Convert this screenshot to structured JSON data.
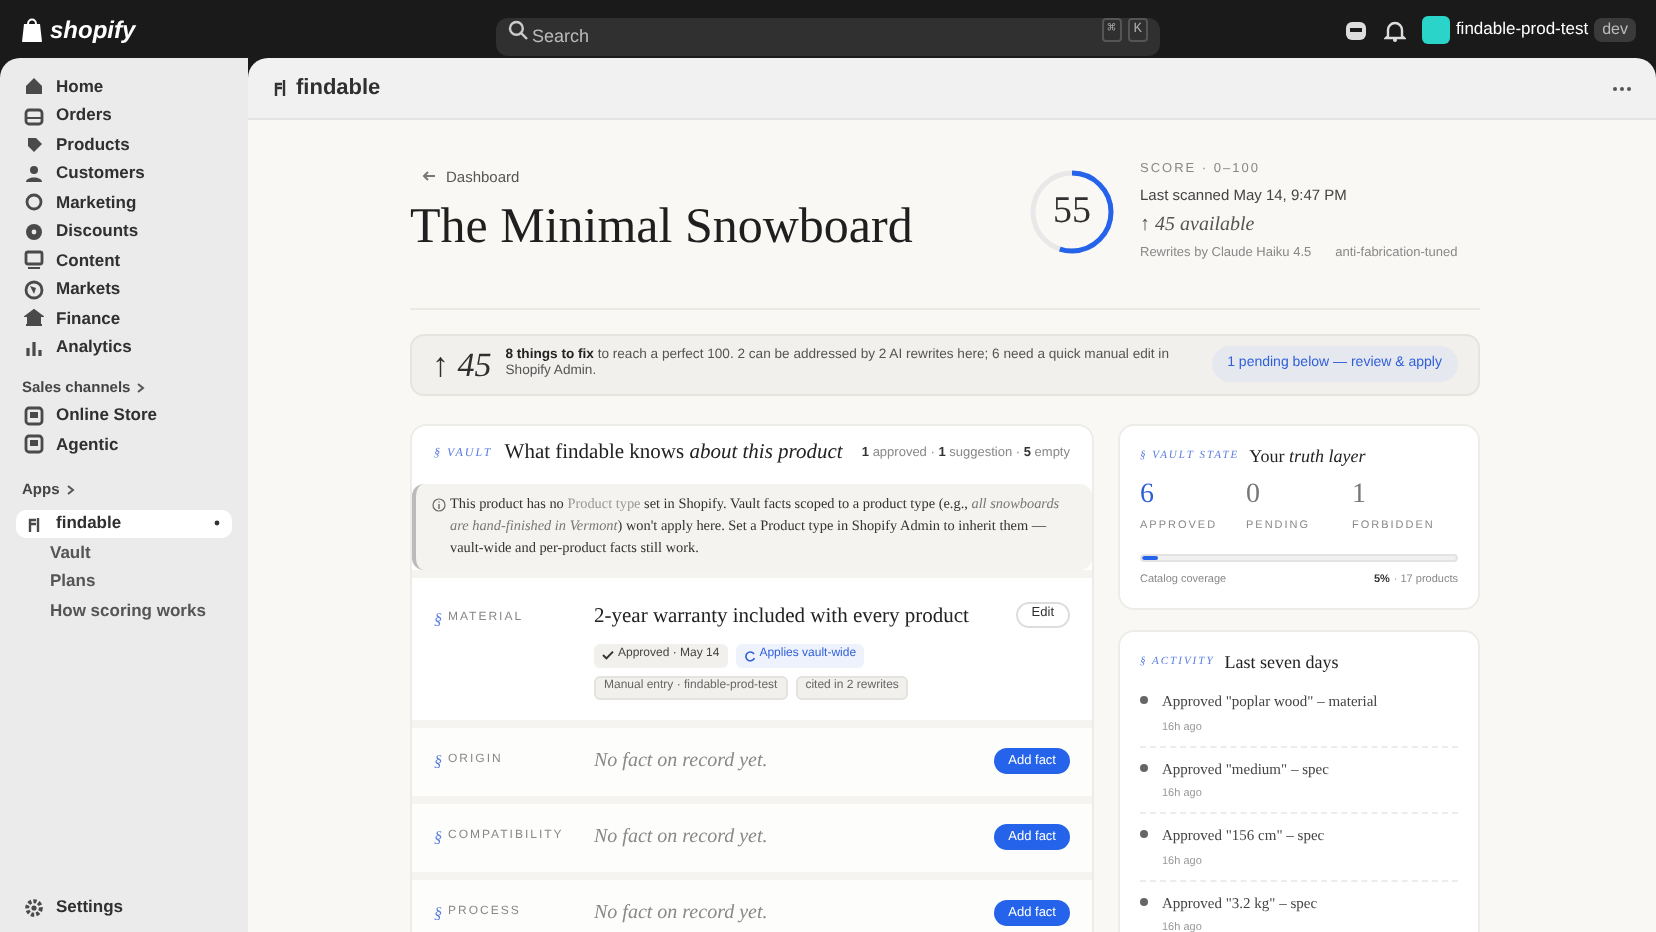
{
  "topbar": {
    "logo": "shopify",
    "search": {
      "placeholder": "Search",
      "keys": [
        "⌘",
        "K"
      ]
    },
    "store": "findable-prod-test",
    "badge": "dev"
  },
  "sidebar": {
    "items": [
      {
        "label": "Home",
        "selected": false
      },
      {
        "label": "Orders",
        "selected": false
      },
      {
        "label": "Products",
        "selected": false
      },
      {
        "label": "Customers",
        "selected": false
      },
      {
        "label": "Marketing",
        "selected": false
      },
      {
        "label": "Discounts",
        "selected": false
      },
      {
        "label": "Content",
        "selected": false
      },
      {
        "label": "Markets",
        "selected": false
      },
      {
        "label": "Finance",
        "selected": false
      },
      {
        "label": "Analytics",
        "selected": false
      }
    ],
    "sales_channels": {
      "heading": "Sales channels",
      "items": [
        {
          "label": "Online Store",
          "selected": false
        },
        {
          "label": "Agentic",
          "selected": false
        }
      ]
    },
    "apps": {
      "heading": "Apps",
      "app": {
        "label": "findable",
        "selected": true,
        "children": [
          {
            "label": "Vault",
            "selected": false
          },
          {
            "label": "Plans",
            "selected": false
          },
          {
            "label": "How scoring works",
            "selected": false
          }
        ]
      }
    },
    "settings": "Settings"
  },
  "app_header": {
    "title": "findable"
  },
  "page": {
    "back": "Dashboard",
    "title": "The Minimal Snowboard",
    "score": {
      "value": "55",
      "level": 0.55,
      "label": "SCORE · 0–100",
      "scanned": "Last scanned May 14, 9:47 PM",
      "available": "↑ 45 available",
      "rewrites": "Rewrites by Claude Haiku 4.5",
      "tuning": "anti-fabrication-tuned"
    }
  },
  "banner": {
    "gain": "↑ 45",
    "text": "**8 things to fix** to reach a perfect 100. 2 can be addressed by 2 AI rewrites here; 6 need a quick manual edit in Shopify Admin.",
    "action": "1 pending below — review & apply"
  },
  "vault": {
    "eyebrow": "§ VAULT",
    "title": "What findable knows *about this product*",
    "counts": "**1** approved · **1** suggestion · **5** empty",
    "notice": [
      {
        "kind": "text",
        "text": "This product has no "
      },
      {
        "kind": "field",
        "text": "Product type"
      },
      {
        "kind": "text",
        "text": " set in Shopify. Vault facts scoped to a product type (e.g., "
      },
      {
        "kind": "example",
        "text": "all snowboards are hand-finished in Vermont"
      },
      {
        "kind": "text",
        "text": ") won't apply here. Set a Product type in Shopify Admin to inherit them — vault-wide and per-product facts still work."
      }
    ],
    "rows": [
      {
        "kind": "fact",
        "sign": "§",
        "label": "MATERIAL",
        "value": "2-year warranty included with every product",
        "button": "Edit",
        "tags": [
          {
            "kind": "approved",
            "text": "Approved · May 14"
          },
          {
            "kind": "scope",
            "text": "Applies vault-wide"
          },
          {
            "kind": "plain",
            "text": "Manual entry · findable-prod-test"
          },
          {
            "kind": "plain",
            "text": "cited in 2 rewrites"
          }
        ]
      },
      {
        "kind": "empty",
        "sign": "§",
        "label": "ORIGIN",
        "value": "No fact on record yet.",
        "button": "Add fact"
      },
      {
        "kind": "empty",
        "sign": "§",
        "label": "COMPATIBILITY",
        "value": "No fact on record yet.",
        "button": "Add fact"
      },
      {
        "kind": "empty",
        "sign": "§",
        "label": "PROCESS",
        "value": "No fact on record yet.",
        "button": "Add fact"
      }
    ]
  },
  "vault_state": {
    "eyebrow": "§ VAULT STATE",
    "title": "Your *truth layer*",
    "stats": [
      {
        "value": "6",
        "label": "APPROVED",
        "accent": true
      },
      {
        "value": "0",
        "label": "PENDING",
        "accent": false
      },
      {
        "value": "1",
        "label": "FORBIDDEN",
        "accent": false
      }
    ],
    "coverage": {
      "label": "Catalog coverage",
      "level": 0.05,
      "percent": "5%",
      "products": "· 17 products"
    }
  },
  "activity": {
    "eyebrow": "§ ACTIVITY",
    "title": "Last seven days",
    "items": [
      {
        "text": "Approved \"poplar wood\" – material",
        "time": "16h ago"
      },
      {
        "text": "Approved \"medium\" – spec",
        "time": "16h ago"
      },
      {
        "text": "Approved \"156 cm\" – spec",
        "time": "16h ago"
      },
      {
        "text": "Approved \"3.2 kg\" – spec",
        "time": "16h ago"
      }
    ]
  }
}
